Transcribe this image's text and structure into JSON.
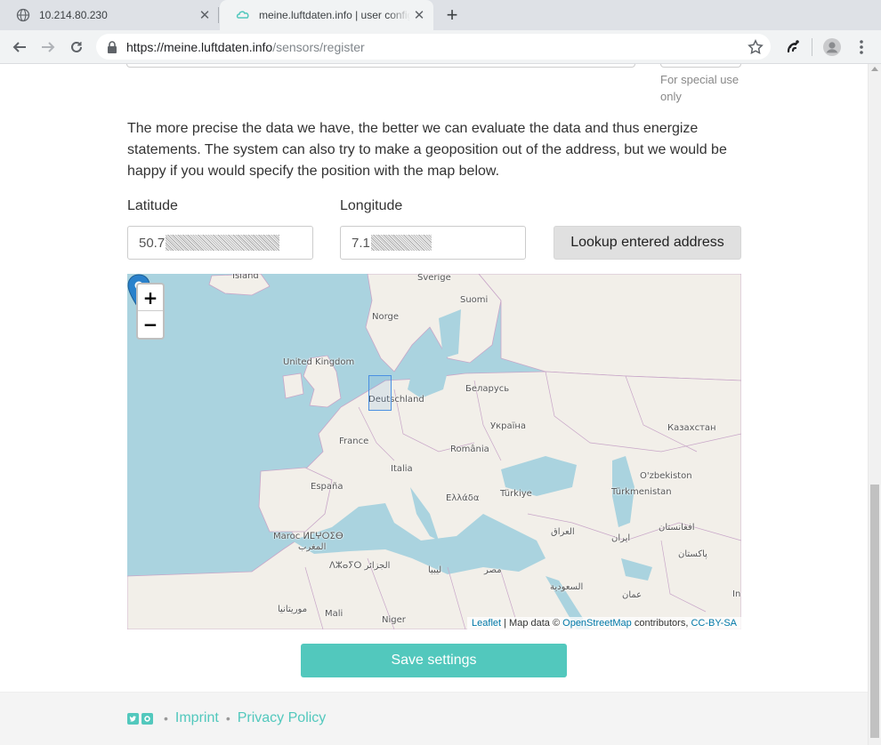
{
  "browser": {
    "tabs": [
      {
        "title": "10.214.80.230",
        "icon": "globe-icon",
        "active": false
      },
      {
        "title": "meine.luftdaten.info | user configura",
        "icon": "luftdaten-cloud-icon",
        "active": true
      }
    ],
    "new_tab_label": "+",
    "url_host": "https://meine.luftdaten.info",
    "url_path": "/sensors/register"
  },
  "page": {
    "special_use_note": "For special use only",
    "intro_text": "The more precise the data we have, the better we can evaluate the data and thus energize statements. The system can also try to make a geoposition out of the address, but we would be happy if you would specify the position with the map below.",
    "latitude": {
      "label": "Latitude",
      "value_visible": "50.7"
    },
    "longitude": {
      "label": "Longitude",
      "value_visible": "7.1"
    },
    "lookup_label": "Lookup entered address",
    "save_label": "Save settings"
  },
  "map": {
    "zoom_in": "+",
    "zoom_out": "−",
    "labels": {
      "island": "Island",
      "sverige": "Sverige",
      "suomi": "Suomi",
      "norge": "Norge",
      "uk": "United Kingdom",
      "belarus": "Беларусь",
      "deutschland": "Deutschland",
      "ukraine": "Україна",
      "kazakhstan": "Казахстан",
      "france": "France",
      "romania": "România",
      "italia": "Italia",
      "uzbekistan": "O'zbekiston",
      "espana": "España",
      "turkmenistan": "Türkmenistan",
      "turkiye": "Türkiye",
      "greece": "Ελλάδα",
      "iraq": "العراق",
      "iran": "ايران",
      "afghanistan": "افغانستان",
      "maroc": "Maroc ⵍⵎⵖⵔⵉⴱ",
      "maghrib": "المغرب",
      "pakistan": "پاکستان",
      "algeria": "ⴷⵣⴰⵢⵔ الجزائر",
      "libya": "ليبيا",
      "egypt": "مصر",
      "saudi": "السعودية",
      "oman": "عمان",
      "mauritania": "موريتانيا",
      "mali": "Mali",
      "niger": "Niger",
      "india": "In"
    },
    "attribution": {
      "leaflet": "Leaflet",
      "sep": " | Map data © ",
      "osm": "OpenStreetMap",
      "contrib": " contributors, ",
      "license": "CC-BY-SA"
    }
  },
  "footer": {
    "imprint": "Imprint",
    "privacy": "Privacy Policy",
    "separator": "•"
  },
  "colors": {
    "accent": "#52c8bd",
    "sea": "#aad3df",
    "land": "#f2efe9",
    "link": "#0078a8"
  }
}
